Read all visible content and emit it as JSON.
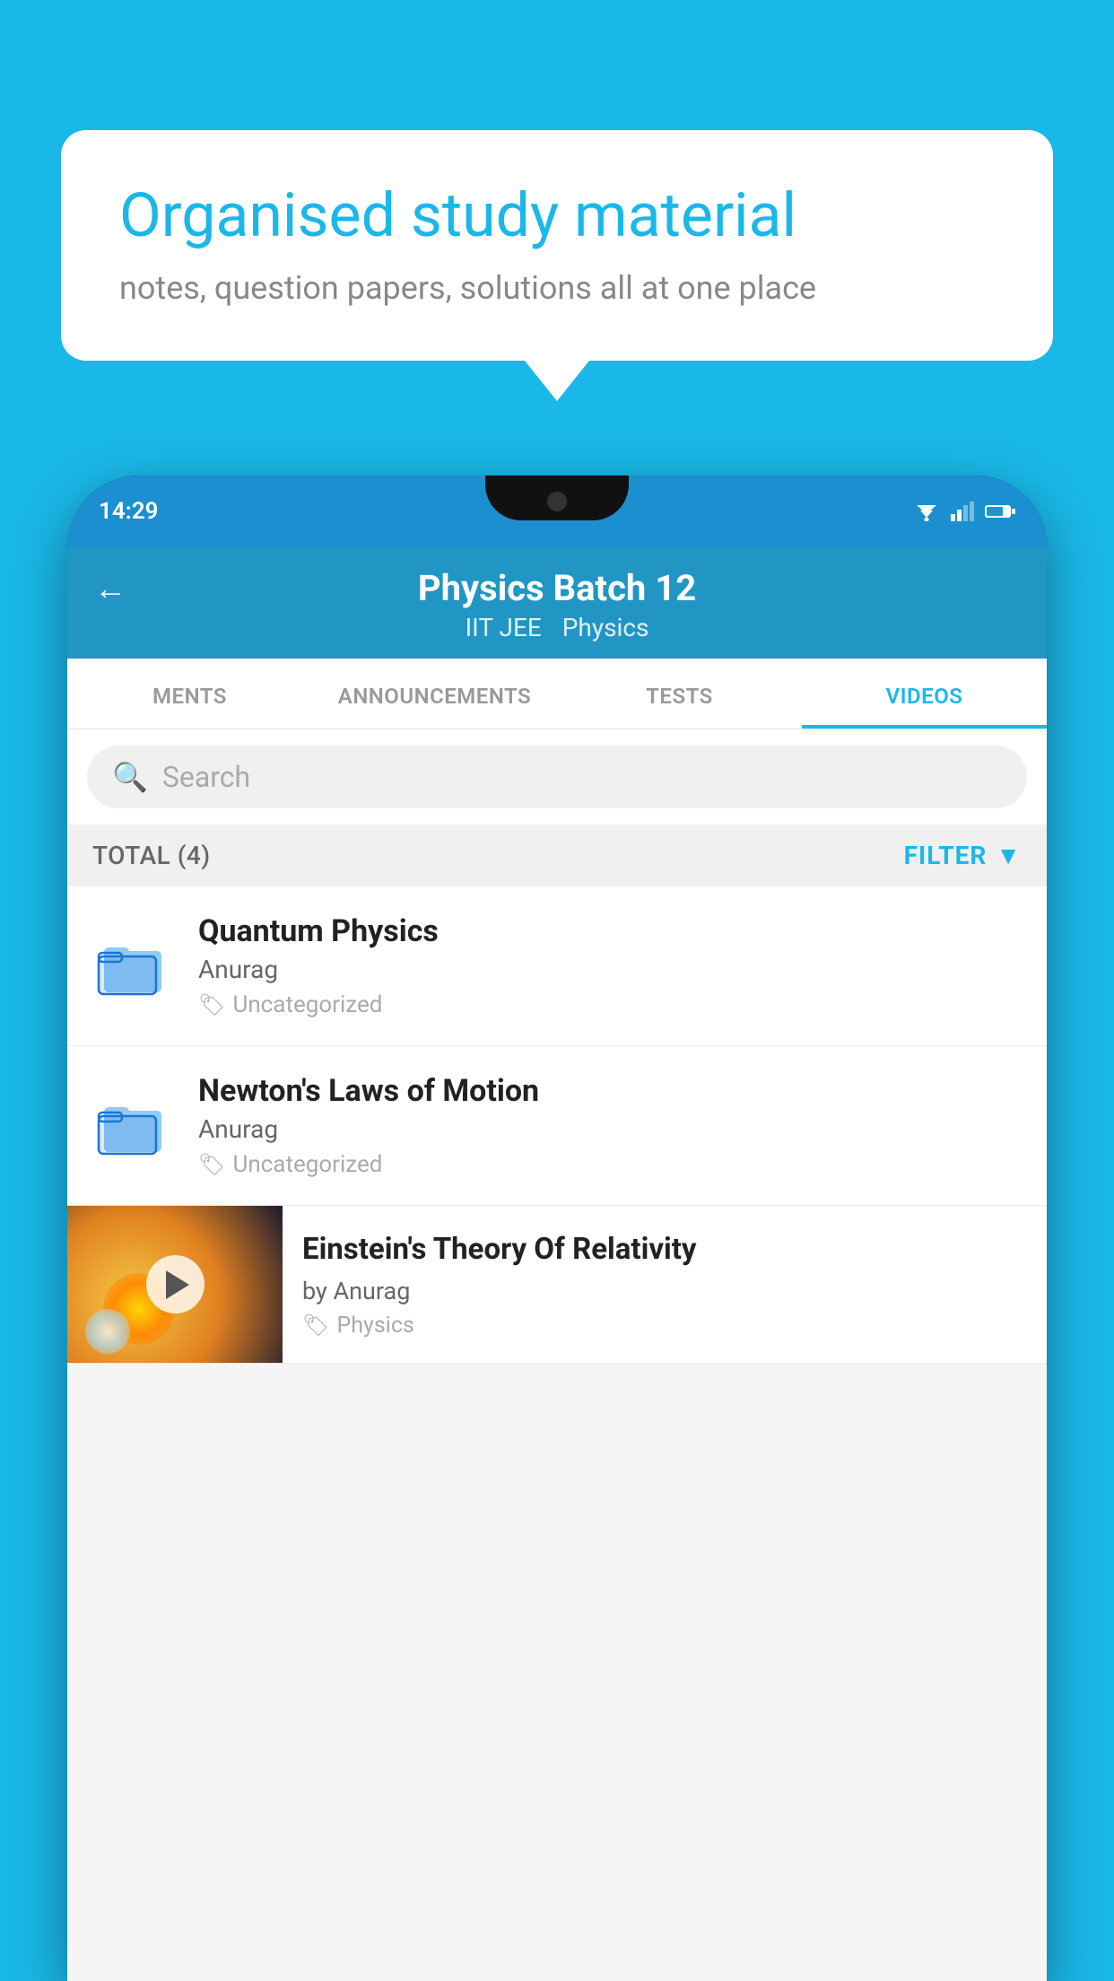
{
  "background": {
    "color": "#1ab8e8"
  },
  "speech_bubble": {
    "title": "Organised study material",
    "subtitle": "notes, question papers, solutions all at one place"
  },
  "status_bar": {
    "time": "14:29"
  },
  "app_header": {
    "back_label": "←",
    "title": "Physics Batch 12",
    "subtitle_tag1": "IIT JEE",
    "subtitle_tag2": "Physics"
  },
  "tabs": [
    {
      "label": "MENTS",
      "active": false
    },
    {
      "label": "ANNOUNCEMENTS",
      "active": false
    },
    {
      "label": "TESTS",
      "active": false
    },
    {
      "label": "VIDEOS",
      "active": true
    }
  ],
  "search": {
    "placeholder": "Search"
  },
  "filter_bar": {
    "total_label": "TOTAL (4)",
    "filter_label": "FILTER"
  },
  "videos": [
    {
      "id": 1,
      "title": "Quantum Physics",
      "author": "Anurag",
      "tag": "Uncategorized",
      "type": "folder"
    },
    {
      "id": 2,
      "title": "Newton's Laws of Motion",
      "author": "Anurag",
      "tag": "Uncategorized",
      "type": "folder"
    },
    {
      "id": 3,
      "title": "Einstein's Theory Of Relativity",
      "author": "by Anurag",
      "tag": "Physics",
      "type": "thumbnail"
    }
  ]
}
